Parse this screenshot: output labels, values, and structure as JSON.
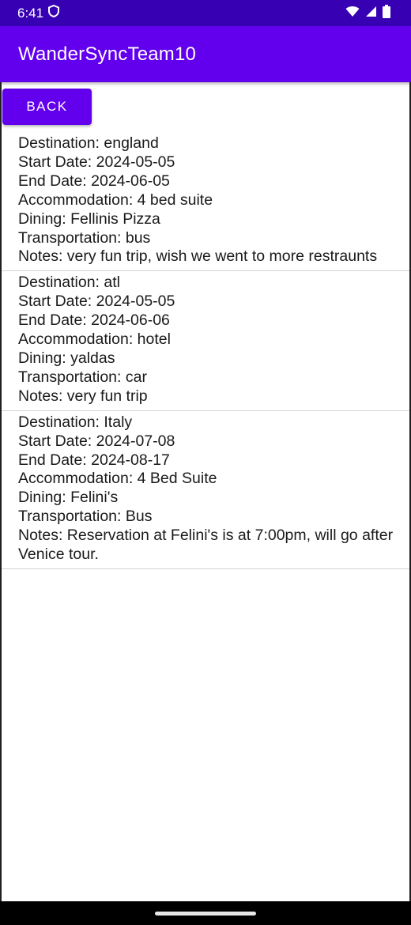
{
  "status_bar": {
    "time": "6:41",
    "icons": [
      "shield-icon",
      "wifi-icon",
      "signal-icon",
      "battery-icon"
    ]
  },
  "app_bar": {
    "title": "WanderSyncTeam10"
  },
  "back_button": {
    "label": "BACK"
  },
  "colors": {
    "status_bar": "#3700b3",
    "primary": "#6200ee",
    "background": "#ffffff",
    "divider": "#d4d4d4"
  },
  "trips": [
    {
      "destination": "Destination: england",
      "start_date": "Start Date: 2024-05-05",
      "end_date": "End Date: 2024-06-05",
      "accommodation": "Accommodation: 4 bed suite",
      "dining": "Dining: Fellinis Pizza",
      "transportation": "Transportation: bus",
      "notes": "Notes: very fun trip, wish we went to more restraunts"
    },
    {
      "destination": "Destination: atl",
      "start_date": "Start Date: 2024-05-05",
      "end_date": "End Date: 2024-06-06",
      "accommodation": "Accommodation: hotel",
      "dining": "Dining: yaldas",
      "transportation": "Transportation: car",
      "notes": "Notes: very fun trip"
    },
    {
      "destination": "Destination: Italy",
      "start_date": "Start Date: 2024-07-08",
      "end_date": "End Date: 2024-08-17",
      "accommodation": "Accommodation: 4 Bed Suite",
      "dining": "Dining: Felini's",
      "transportation": "Transportation: Bus",
      "notes": "Notes: Reservation at Felini's is at 7:00pm, will go after Venice tour."
    }
  ]
}
